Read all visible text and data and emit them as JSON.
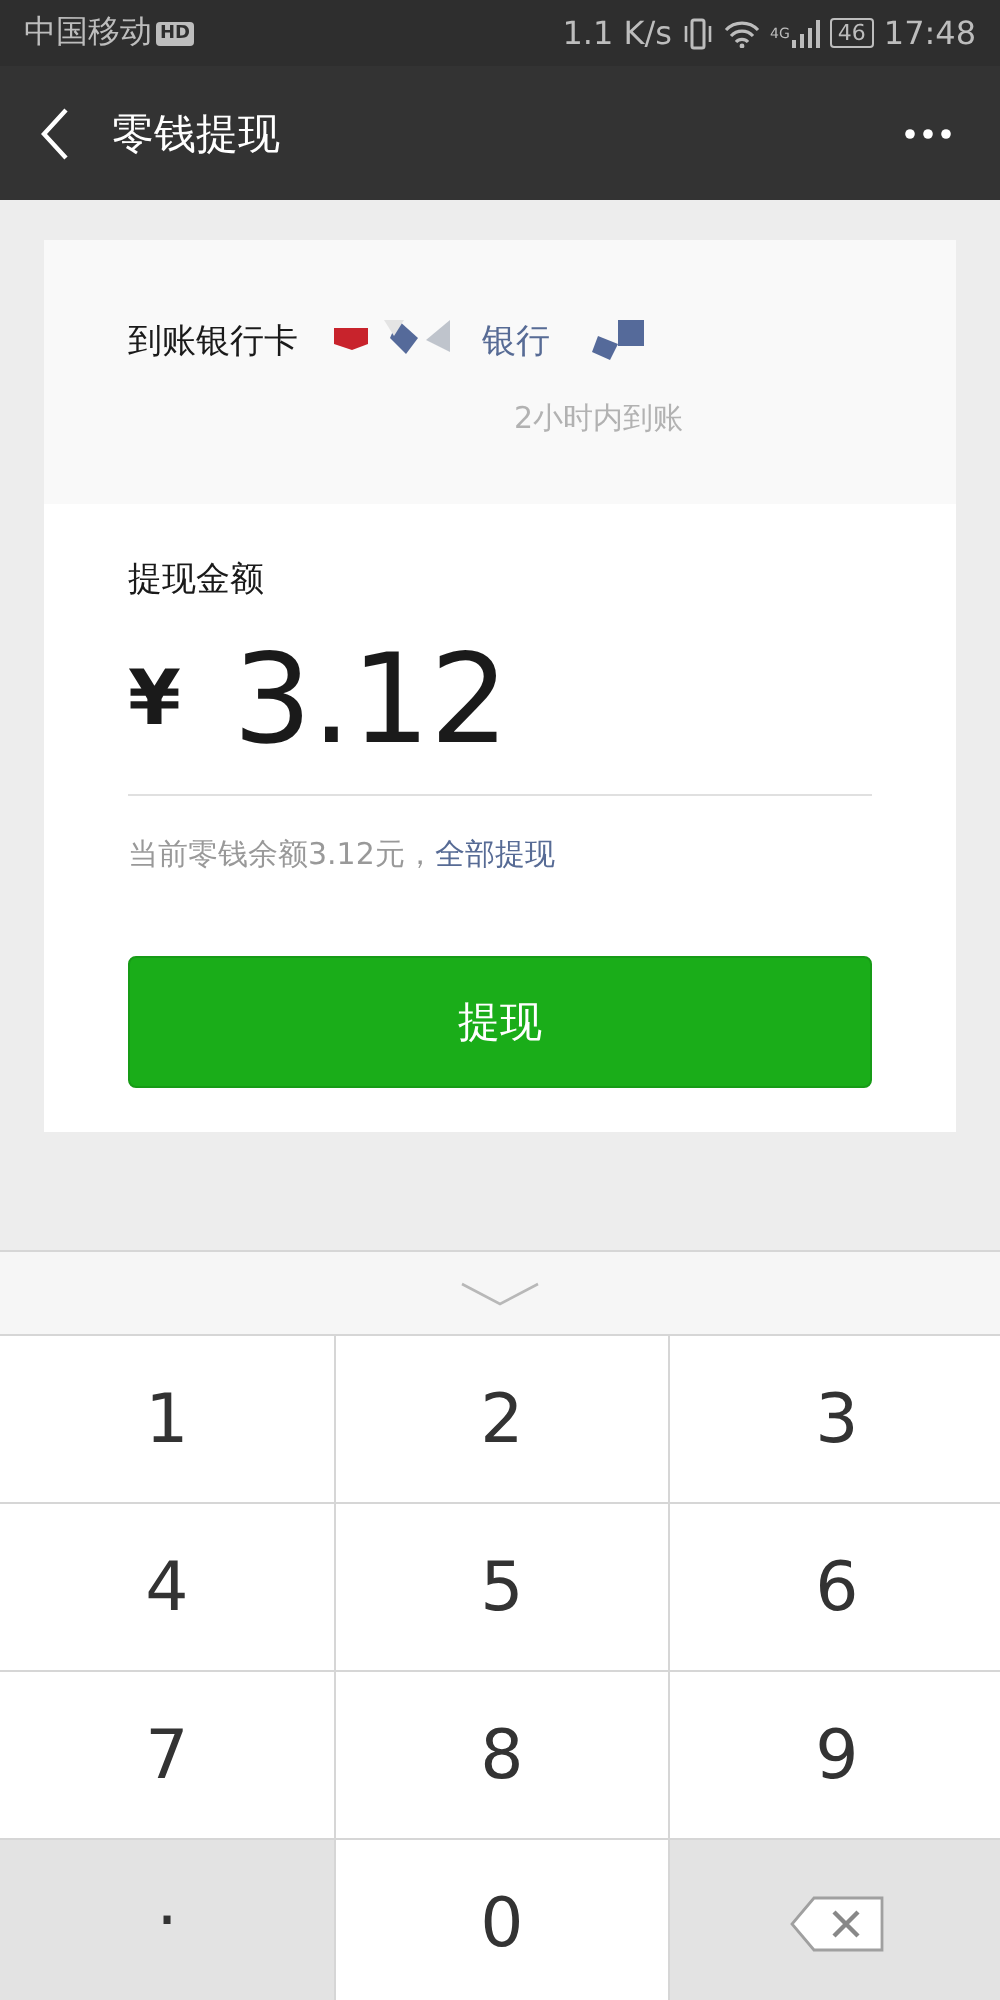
{
  "status_bar": {
    "carrier": "中国移动",
    "hd_badge": "HD",
    "speed": "1.1 K/s",
    "network": "4G",
    "battery": "46",
    "time": "17:48"
  },
  "nav_bar": {
    "title": "零钱提现"
  },
  "bank": {
    "label": "到账银行卡",
    "bank_name": "银行",
    "arrival_time": "2小时内到账"
  },
  "amount": {
    "label": "提现金额",
    "currency": "¥",
    "value": "3.12"
  },
  "balance": {
    "text": "当前零钱余额3.12元，",
    "link": "全部提现"
  },
  "submit_button": "提现",
  "keypad": [
    {
      "kind": "digit",
      "label": "1"
    },
    {
      "kind": "digit",
      "label": "2"
    },
    {
      "kind": "digit",
      "label": "3"
    },
    {
      "kind": "digit",
      "label": "4"
    },
    {
      "kind": "digit",
      "label": "5"
    },
    {
      "kind": "digit",
      "label": "6"
    },
    {
      "kind": "digit",
      "label": "7"
    },
    {
      "kind": "digit",
      "label": "8"
    },
    {
      "kind": "digit",
      "label": "9"
    },
    {
      "kind": "function",
      "label": "."
    },
    {
      "kind": "digit",
      "label": "0"
    },
    {
      "kind": "backspace"
    }
  ]
}
